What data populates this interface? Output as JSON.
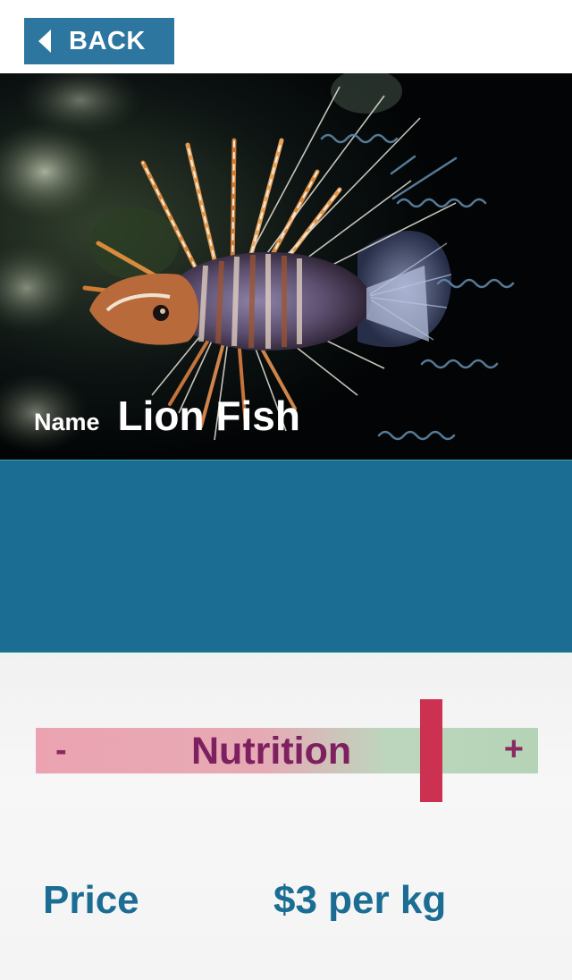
{
  "header": {
    "back_label": "BACK"
  },
  "fish": {
    "name_tag": "Name",
    "name": "Lion Fish"
  },
  "nutrition": {
    "minus": "-",
    "label": "Nutrition",
    "plus": "+",
    "level": 0.8
  },
  "price": {
    "label": "Price",
    "value": "$3 per kg"
  },
  "colors": {
    "primary_blue": "#1b6d93",
    "button_blue": "#2d76a0",
    "handle_red": "#cc3152",
    "nutrition_text": "#7e1f60"
  }
}
